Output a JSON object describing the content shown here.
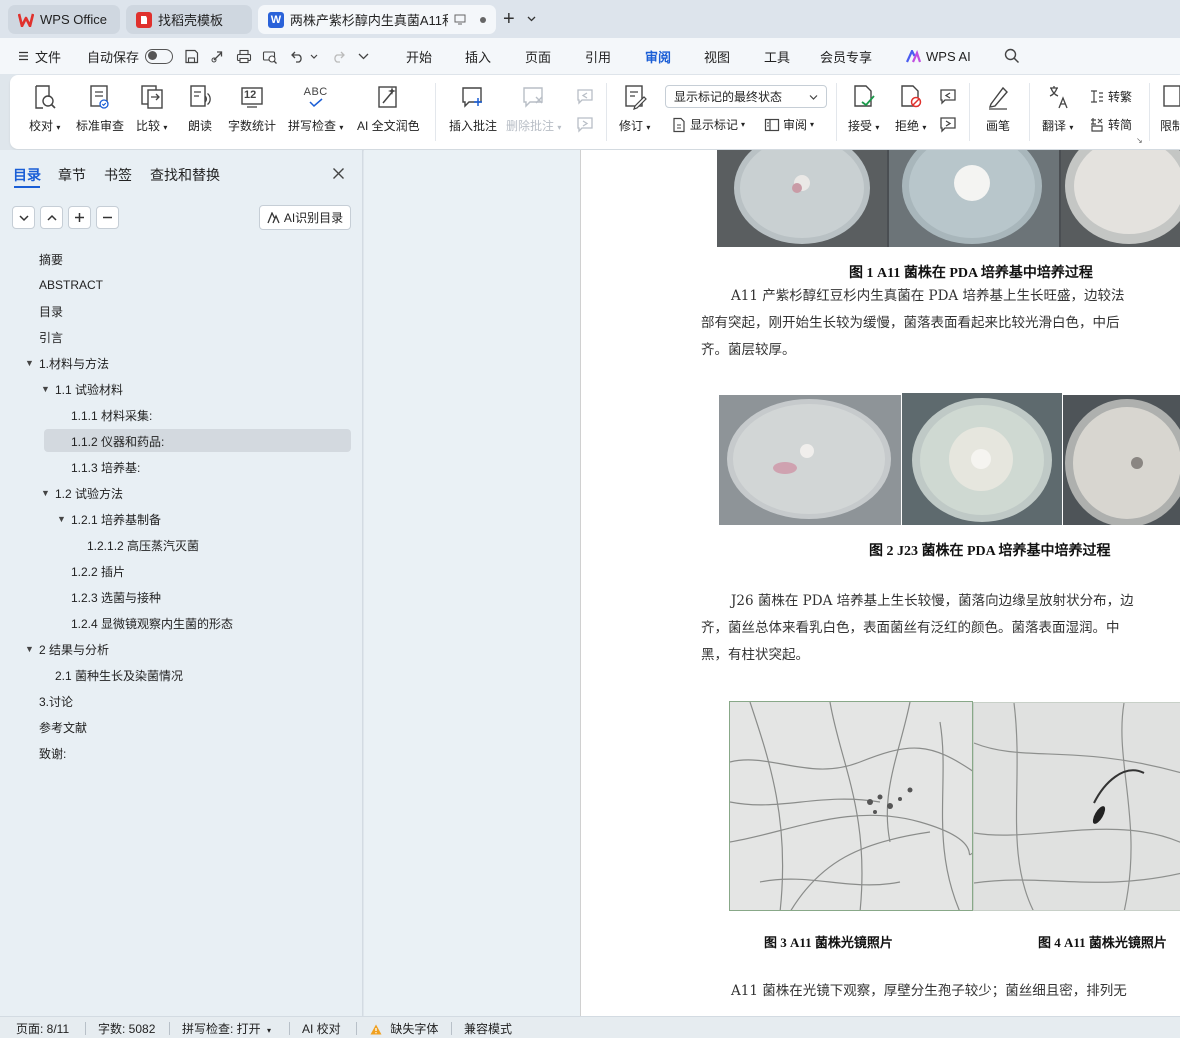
{
  "tabs": [
    {
      "label": "WPS Office",
      "icon": "wps-logo-icon"
    },
    {
      "label": "找稻壳模板",
      "icon": "docer-logo-icon"
    },
    {
      "label": "两株产紫杉醇内生真菌A11和...",
      "icon": "word-doc-icon"
    }
  ],
  "menubar": {
    "file": "文件",
    "autosave": "自动保存",
    "items": [
      "开始",
      "插入",
      "页面",
      "引用",
      "审阅",
      "视图",
      "工具",
      "会员专享"
    ],
    "active": "审阅",
    "wps_ai": "WPS AI"
  },
  "ribbon": {
    "proofread": "校对",
    "standard_review": "标准审查",
    "compare": "比较",
    "read_aloud": "朗读",
    "word_count": "字数统计",
    "word_count_icon_text": "12",
    "spell_check": "拼写检查",
    "spell_icon_text": "ABC",
    "ai_polish": "AI 全文润色",
    "insert_comment": "插入批注",
    "delete_comment": "删除批注",
    "track_changes": "修订",
    "markup_state": "显示标记的最终状态",
    "show_markup": "显示标记",
    "review_pane": "审阅",
    "accept": "接受",
    "reject": "拒绝",
    "pen": "画笔",
    "translate": "翻译",
    "to_traditional": "转繁",
    "to_simplified": "转简",
    "restrict": "限制"
  },
  "nav": {
    "tabs": [
      "目录",
      "章节",
      "书签",
      "查找和替换"
    ],
    "ai_toc": "AI识别目录",
    "toc": [
      {
        "label": "摘要",
        "level": 1,
        "arrow": false,
        "selected": false
      },
      {
        "label": "ABSTRACT",
        "level": 1,
        "arrow": false,
        "selected": false
      },
      {
        "label": "目录",
        "level": 1,
        "arrow": false,
        "selected": false
      },
      {
        "label": "引言",
        "level": 1,
        "arrow": false,
        "selected": false
      },
      {
        "label": "1.材料与方法",
        "level": 1,
        "arrow": true,
        "selected": false
      },
      {
        "label": "1.1 试验材料",
        "level": 2,
        "arrow": true,
        "selected": false
      },
      {
        "label": "1.1.1 材料采集:",
        "level": 3,
        "arrow": false,
        "selected": false
      },
      {
        "label": "1.1.2 仪器和药品:",
        "level": 3,
        "arrow": false,
        "selected": true
      },
      {
        "label": "1.1.3  培养基:",
        "level": 3,
        "arrow": false,
        "selected": false
      },
      {
        "label": "1.2 试验方法",
        "level": 2,
        "arrow": true,
        "selected": false
      },
      {
        "label": "1.2.1 培养基制备",
        "level": 3,
        "arrow": true,
        "selected": false
      },
      {
        "label": "1.2.1.2  高压蒸汽灭菌",
        "level": 4,
        "arrow": false,
        "selected": false
      },
      {
        "label": "1.2.2  插片",
        "level": 3,
        "arrow": false,
        "selected": false
      },
      {
        "label": "1.2.3 选菌与接种",
        "level": 3,
        "arrow": false,
        "selected": false
      },
      {
        "label": "1.2.4  显微镜观察内生菌的形态",
        "level": 3,
        "arrow": false,
        "selected": false
      },
      {
        "label": "2 结果与分析",
        "level": 1,
        "arrow": true,
        "selected": false
      },
      {
        "label": "2.1  菌种生长及染菌情况",
        "level": 2,
        "arrow": false,
        "selected": false
      },
      {
        "label": "3.讨论",
        "level": 1,
        "arrow": false,
        "selected": false
      },
      {
        "label": "参考文献",
        "level": 1,
        "arrow": false,
        "selected": false
      },
      {
        "label": "致谢:",
        "level": 1,
        "arrow": false,
        "selected": false
      }
    ]
  },
  "doc": {
    "fig1_caption": "图 1   A11 菌株在 PDA 培养基中培养过程",
    "para1": [
      "A11 产紫杉醇红豆杉内生真菌在 PDA 培养基上生长旺盛，边较法",
      "部有突起，刚开始生长较为缓慢，菌落表面看起来比较光滑白色，中后",
      "齐。菌层较厚。"
    ],
    "fig2_caption": "图 2  J23 菌株在 PDA 培养基中培养过程",
    "para2": [
      "J26  菌株在 PDA 培养基上生长较慢，菌落向边缘呈放射状分布，边",
      "齐，菌丝总体来看乳白色，表面菌丝有泛红的颜色。菌落表面湿润。中",
      "黑，有柱状突起。"
    ],
    "fig3_caption": "图 3  A11  菌株光镜照片",
    "fig4_caption": "图 4  A11  菌株光镜照片",
    "para3": "A11 菌株在光镜下观察，厚壁分生孢子较少；菌丝细且密，排列无"
  },
  "status": {
    "page": "页面: 8/11",
    "words": "字数: 5082",
    "spell": "拼写检查: 打开",
    "ai_check": "AI 校对",
    "missing_font": "缺失字体",
    "compat": "兼容模式"
  },
  "colors": {
    "accent": "#1a5ed6",
    "wps_red": "#e0312d",
    "word_blue": "#2a62d9"
  }
}
